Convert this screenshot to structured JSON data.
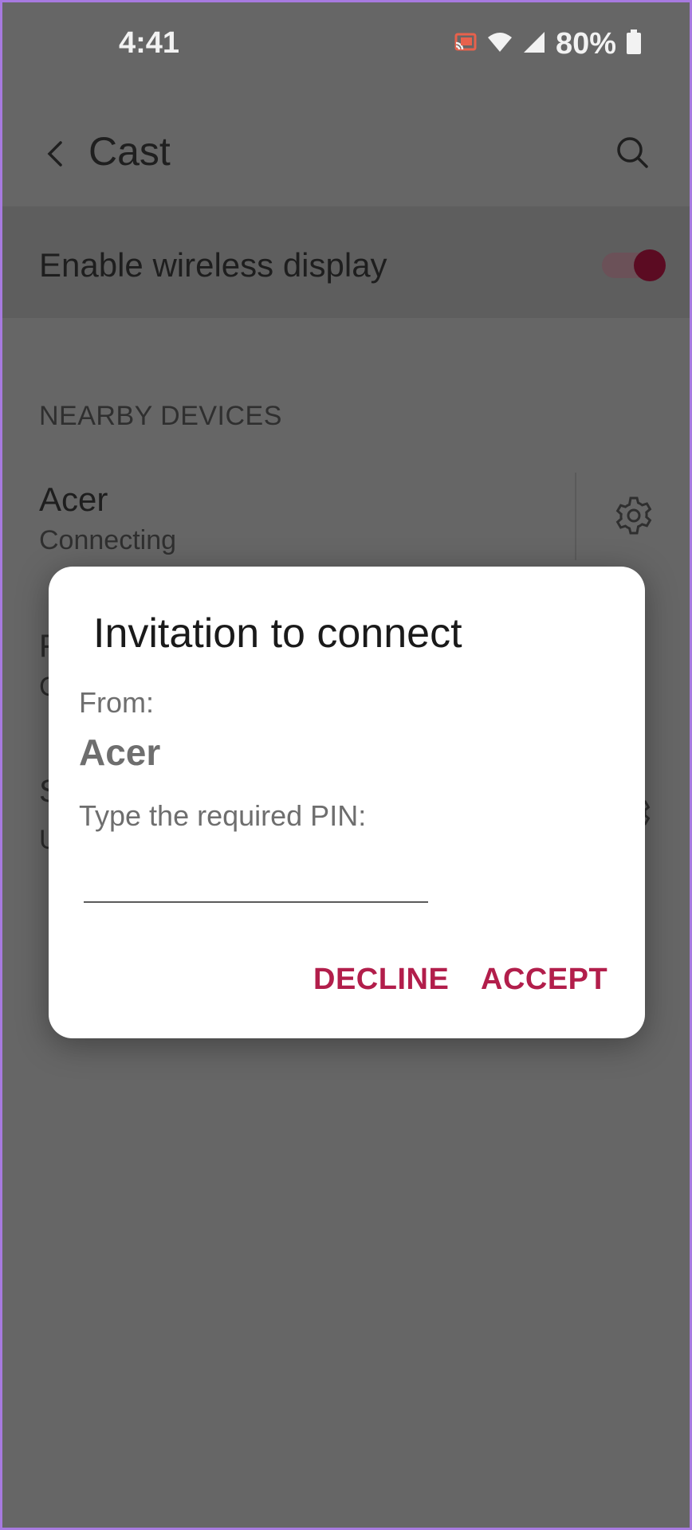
{
  "status_bar": {
    "time": "4:41",
    "battery": "80%",
    "icons": [
      "cast-icon",
      "wifi-icon",
      "signal-icon",
      "battery-icon"
    ]
  },
  "app_bar": {
    "title": "Cast",
    "icons": [
      "back-arrow-icon",
      "search-icon"
    ]
  },
  "wireless_display": {
    "label": "Enable wireless display",
    "enabled": true
  },
  "nearby_devices": {
    "header": "NEARBY DEVICES",
    "devices": [
      {
        "name": "Acer",
        "status": "Connecting"
      }
    ],
    "peek_chars": [
      "F",
      "C",
      "S",
      "U"
    ]
  },
  "dialog": {
    "title": "Invitation to connect",
    "from_label": "From:",
    "from_device": "Acer",
    "pin_label": "Type the required PIN:",
    "pin_value": "",
    "decline_label": "DECLINE",
    "accept_label": "ACCEPT"
  },
  "colors": {
    "accent": "#b21e4b",
    "frame_border": "#a77ae0",
    "scrim_background": "#666666"
  }
}
